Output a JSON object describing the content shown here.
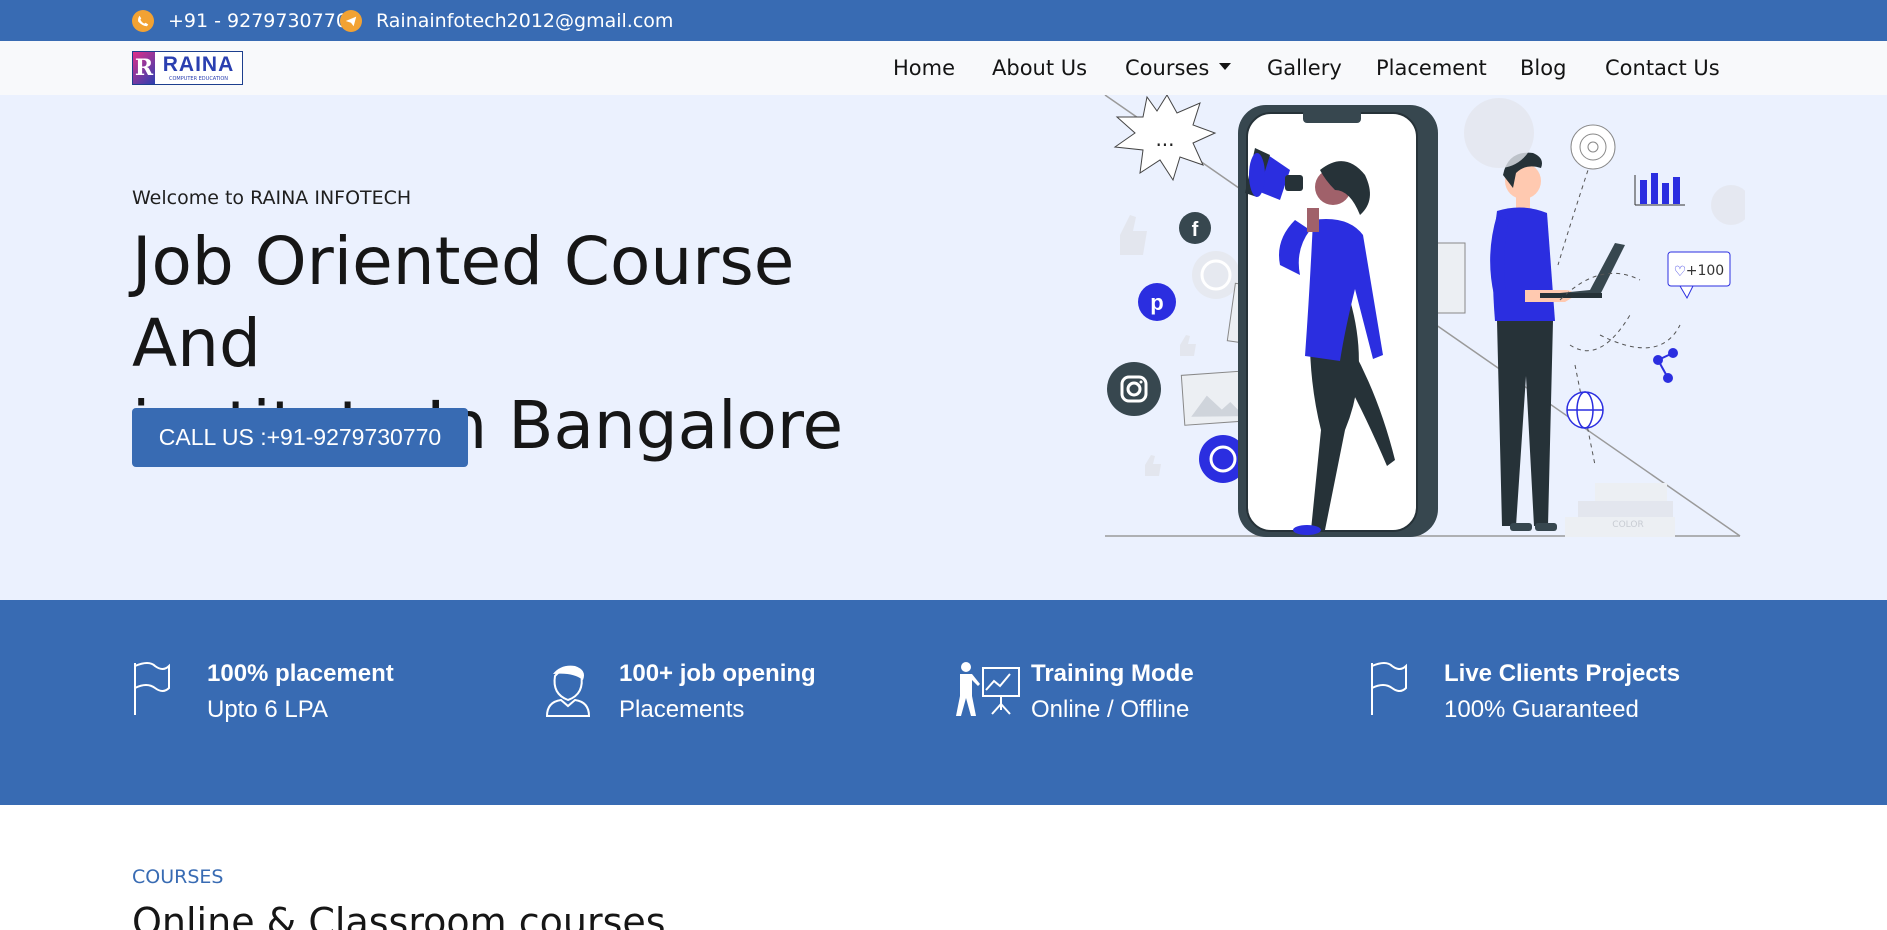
{
  "topbar": {
    "phone": "+91 - 9279730770",
    "email": "Rainainfotech2012@gmail.com",
    "phone_icon": "phone-icon",
    "email_icon": "send-icon",
    "accent_color": "#f2a233",
    "background_color": "#386bb3"
  },
  "logo": {
    "mark": "R",
    "name": "RAINA",
    "tagline": "COMPUTER EDUCATION"
  },
  "nav": {
    "items": [
      "Home",
      "About Us",
      "Courses",
      "Gallery",
      "Placement",
      "Blog",
      "Contact Us"
    ]
  },
  "hero": {
    "welcome": "Welcome to RAINA INFOTECH",
    "title_line1": "Job Oriented Course And",
    "title_line2": "institute In Bangalore",
    "cta_label": "CALL US :+91-9279730770",
    "illustration_text": {
      "speech": "...",
      "likes": "+100",
      "books": "COLOR"
    },
    "background_color": "#ebf1fe"
  },
  "features": {
    "items": [
      {
        "icon": "flag-icon",
        "title": "100% placement",
        "subtitle": "Upto 6 LPA"
      },
      {
        "icon": "user-icon",
        "title": "100+ job opening",
        "subtitle": "Placements"
      },
      {
        "icon": "trainer-board-icon",
        "title": "Training Mode",
        "subtitle": "Online / Offline"
      },
      {
        "icon": "flag-icon",
        "title": "Live Clients Projects",
        "subtitle": "100% Guaranteed"
      }
    ]
  },
  "courses": {
    "label": "COURSES",
    "title": "Online & Classroom courses"
  },
  "colors": {
    "primary": "#386bb3",
    "illustration_accent": "#2b2ee0",
    "dark": "#263238"
  }
}
